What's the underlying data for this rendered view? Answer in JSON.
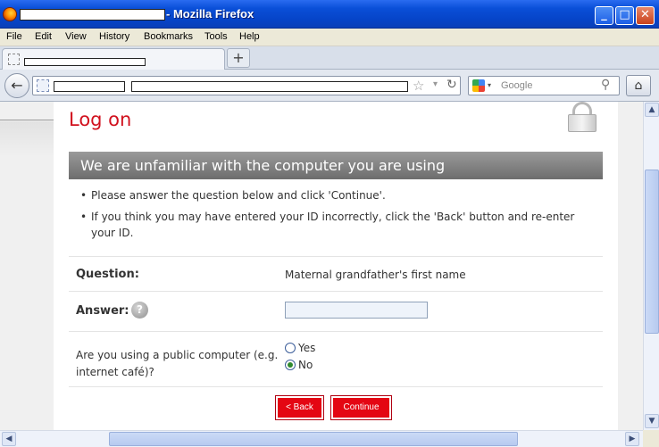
{
  "window": {
    "title_suffix": "- Mozilla Firefox",
    "minimize": "_",
    "maximize": "□",
    "close": "✕"
  },
  "menu": {
    "items": [
      "File",
      "Edit",
      "View",
      "History",
      "Bookmarks",
      "Tools",
      "Help"
    ]
  },
  "tabs": {
    "new_tab": "+"
  },
  "nav": {
    "back": "←",
    "star": "☆",
    "dropdown": "▾",
    "reload": "↻",
    "search_placeholder": "Google",
    "search_icon": "magnifier-icon",
    "home": "⌂"
  },
  "page": {
    "title": "Log on",
    "banner": "We are unfamiliar with the computer you are using",
    "bullets": [
      "Please answer the question below and click 'Continue'.",
      "If you think you may have entered your ID incorrectly, click the 'Back' button and re-enter your ID."
    ],
    "question_label": "Question:",
    "question_value": "Maternal grandfather's first name",
    "answer_label": "Answer:",
    "help_glyph": "?",
    "answer_value": "",
    "public_label": "Are you using a public computer (e.g. internet café)?",
    "option_yes": "Yes",
    "option_no": "No",
    "selected_option": "No",
    "back_button": "< Back",
    "continue_button": "Continue"
  },
  "colors": {
    "accent_red": "#d1111e",
    "button_red": "#e40613",
    "banner_gray": "#7a7a7a"
  }
}
